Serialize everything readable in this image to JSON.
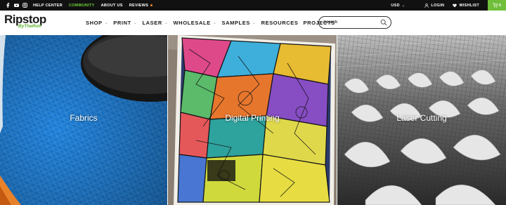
{
  "topbar": {
    "links": [
      {
        "label": "HELP CENTER"
      },
      {
        "label": "COMMUNITY"
      },
      {
        "label": "ABOUT US"
      },
      {
        "label": "REVIEWS"
      }
    ],
    "currency": "USD",
    "login": "LOGIN",
    "wishlist": "WISHLIST",
    "cart_count": "0"
  },
  "header": {
    "logo_main": "Ripstop",
    "logo_sub": "ByTheRoll",
    "nav": [
      {
        "label": "SHOP"
      },
      {
        "label": "PRINT"
      },
      {
        "label": "LASER"
      },
      {
        "label": "WHOLESALE"
      },
      {
        "label": "SAMPLES"
      },
      {
        "label": "RESOURCES"
      },
      {
        "label": "PROJECTS"
      }
    ],
    "search_placeholder": "Search"
  },
  "tiles": [
    {
      "label": "Fabrics"
    },
    {
      "label": "Digital Printing"
    },
    {
      "label": "Laser Cutting"
    }
  ],
  "colors": {
    "accent": "#6fbf3a",
    "topbar_bg": "#111111"
  }
}
